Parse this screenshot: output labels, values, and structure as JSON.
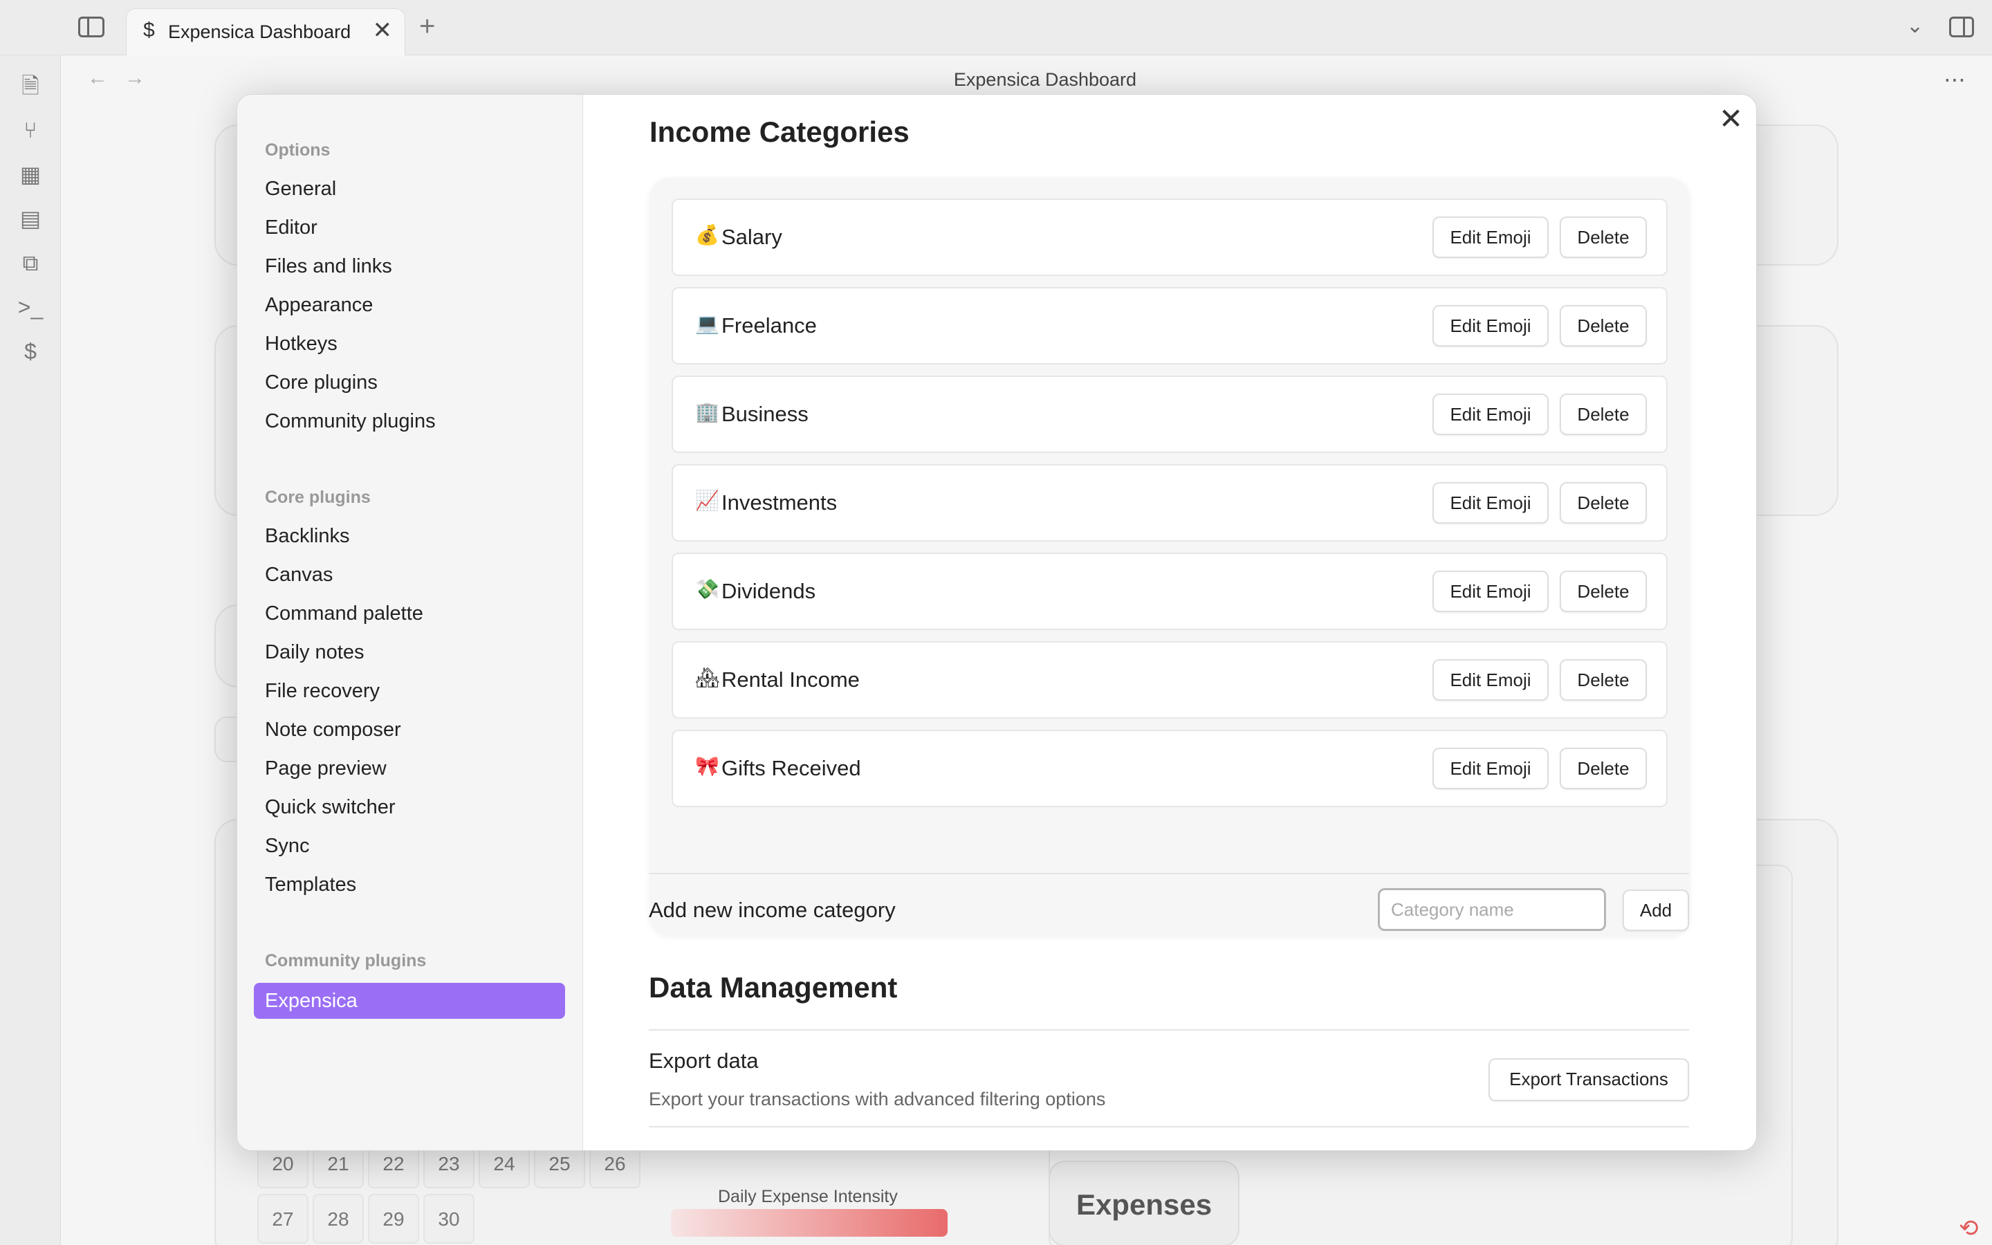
{
  "tab": {
    "icon": "$",
    "title": "Expensica Dashboard",
    "close": "✕",
    "new": "+"
  },
  "view": {
    "title": "Expensica Dashboard",
    "back": "←",
    "forward": "→",
    "more": "⋯"
  },
  "ribbon": {
    "icons": [
      "file-search-icon",
      "graph-icon",
      "dashboard-icon",
      "calendar-icon",
      "pages-icon",
      "terminal-icon",
      "dollar-icon"
    ]
  },
  "background": {
    "calendar_days": [
      "20",
      "21",
      "22",
      "23",
      "24",
      "25",
      "26",
      "27",
      "28",
      "29",
      "30"
    ],
    "intensity_label": "Daily Expense Intensity",
    "expenses_label": "Expenses"
  },
  "settings": {
    "sidebar": {
      "options_heading": "Options",
      "options": [
        "General",
        "Editor",
        "Files and links",
        "Appearance",
        "Hotkeys",
        "Core plugins",
        "Community plugins"
      ],
      "core_heading": "Core plugins",
      "core": [
        "Backlinks",
        "Canvas",
        "Command palette",
        "Daily notes",
        "File recovery",
        "Note composer",
        "Page preview",
        "Quick switcher",
        "Sync",
        "Templates"
      ],
      "community_heading": "Community plugins",
      "community": [
        "Expensica"
      ]
    },
    "close": "✕",
    "income": {
      "title": "Income Categories",
      "categories": [
        {
          "emoji": "💰",
          "name": "Salary"
        },
        {
          "emoji": "💻",
          "name": "Freelance"
        },
        {
          "emoji": "🏢",
          "name": "Business"
        },
        {
          "emoji": "📈",
          "name": "Investments"
        },
        {
          "emoji": "💸",
          "name": "Dividends"
        },
        {
          "emoji": "🏘",
          "name": "Rental Income"
        },
        {
          "emoji": "🎀",
          "name": "Gifts Received"
        }
      ],
      "edit_label": "Edit Emoji",
      "delete_label": "Delete",
      "add_label": "Add new income category",
      "add_placeholder": "Category name",
      "add_button": "Add"
    },
    "data_management": {
      "title": "Data Management",
      "export_label": "Export data",
      "export_desc": "Export your transactions with advanced filtering options",
      "export_button": "Export Transactions"
    }
  },
  "status": {
    "sync_icon": "sync-error-icon"
  }
}
